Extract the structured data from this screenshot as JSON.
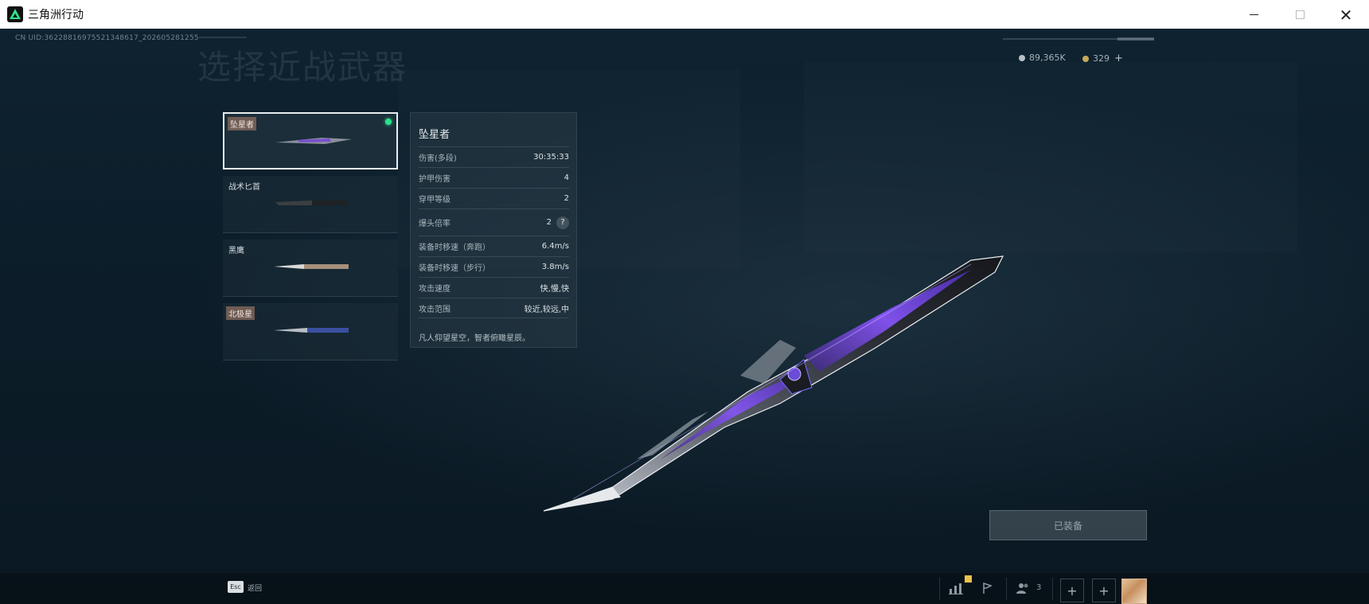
{
  "window": {
    "title": "三角洲行动",
    "controls": {
      "minimize": "—",
      "maximize": "☐",
      "close": "✕"
    }
  },
  "header": {
    "uid": "CN UID:3622881697552134861​7_202605281255",
    "page_title": "选择近战武器",
    "currency": {
      "silver": "89,365K",
      "gold": "329",
      "add": "+"
    }
  },
  "weapons": [
    {
      "name": "坠星者",
      "tagged": true,
      "selected": true,
      "equipped": true
    },
    {
      "name": "战术匕首",
      "tagged": false,
      "selected": false,
      "equipped": false
    },
    {
      "name": "黑鹰",
      "tagged": false,
      "selected": false,
      "equipped": false
    },
    {
      "name": "北极星",
      "tagged": true,
      "selected": false,
      "equipped": false
    }
  ],
  "stats": {
    "title": "坠星者",
    "rows": [
      {
        "label": "伤害(多段)",
        "value": "30:35:33"
      },
      {
        "label": "护甲伤害",
        "value": "4"
      },
      {
        "label": "穿甲等级",
        "value": "2"
      },
      {
        "label": "爆头倍率",
        "value": "2",
        "help": "?"
      },
      {
        "label": "装备时移速（奔跑）",
        "value": "6.4m/s"
      },
      {
        "label": "装备时移速（步行）",
        "value": "3.8m/s"
      },
      {
        "label": "攻击速度",
        "value": "快,慢,快"
      },
      {
        "label": "攻击范围",
        "value": "较近,较远,中"
      }
    ],
    "description": "凡人仰望星空，智者俯瞰星辰。"
  },
  "equip_button": {
    "label": "已装备"
  },
  "bottom_bar": {
    "esc_key": "Esc",
    "esc_label": "返回",
    "friends_count": "3",
    "add1": "+",
    "add2": "+"
  },
  "icons": [
    "stats-icon",
    "flag-icon",
    "friends-icon",
    "avatar"
  ],
  "colors": {
    "accent": "#2ee08a",
    "background": "#0b1a24",
    "tag": "#8c6e5f"
  }
}
